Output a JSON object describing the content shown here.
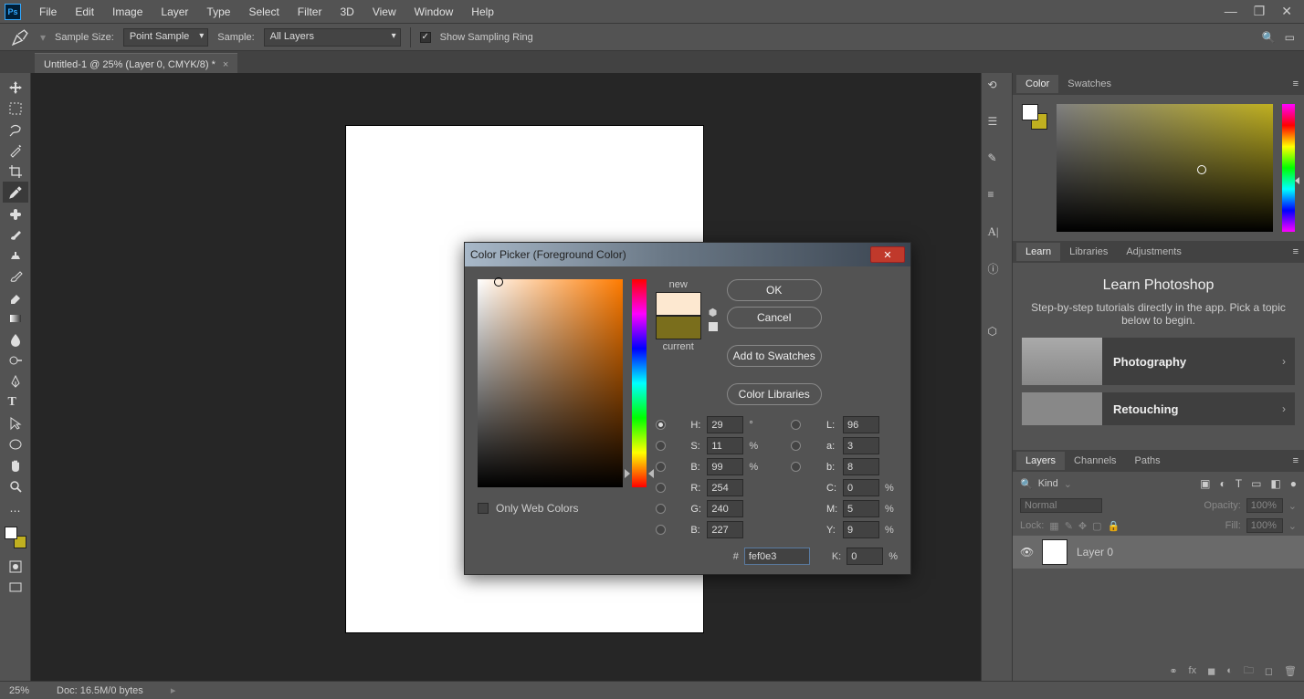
{
  "menubar": {
    "items": [
      "File",
      "Edit",
      "Image",
      "Layer",
      "Type",
      "Select",
      "Filter",
      "3D",
      "View",
      "Window",
      "Help"
    ]
  },
  "optbar": {
    "sample_size_label": "Sample Size:",
    "sample_size_value": "Point Sample",
    "sample_label": "Sample:",
    "sample_value": "All Layers",
    "show_sampling_ring": "Show Sampling Ring"
  },
  "document": {
    "tab_title": "Untitled-1 @ 25% (Layer 0, CMYK/8) *"
  },
  "color_panel": {
    "tabs": [
      "Color",
      "Swatches"
    ]
  },
  "learn_panel": {
    "tabs": [
      "Learn",
      "Libraries",
      "Adjustments"
    ],
    "title": "Learn Photoshop",
    "subtitle": "Step-by-step tutorials directly in the app. Pick a topic below to begin.",
    "items": [
      "Photography",
      "Retouching"
    ]
  },
  "layers_panel": {
    "tabs": [
      "Layers",
      "Channels",
      "Paths"
    ],
    "kind_label": "Kind",
    "blend_mode": "Normal",
    "opacity_label": "Opacity:",
    "opacity_value": "100%",
    "lock_label": "Lock:",
    "fill_label": "Fill:",
    "fill_value": "100%",
    "layer_name": "Layer 0"
  },
  "statusbar": {
    "zoom": "25%",
    "doc": "Doc: 16.5M/0 bytes"
  },
  "dialog": {
    "title": "Color Picker (Foreground Color)",
    "ok": "OK",
    "cancel": "Cancel",
    "add_swatches": "Add to Swatches",
    "libraries": "Color Libraries",
    "new_label": "new",
    "current_label": "current",
    "new_color": "#fde8d0",
    "current_color": "#7a6e1c",
    "only_web": "Only Web Colors",
    "H": "29",
    "S": "11",
    "Bv": "99",
    "R": "254",
    "G": "240",
    "B": "227",
    "L": "96",
    "a": "3",
    "b": "8",
    "C": "0",
    "M": "5",
    "Y": "9",
    "K": "0",
    "hex": "fef0e3"
  }
}
